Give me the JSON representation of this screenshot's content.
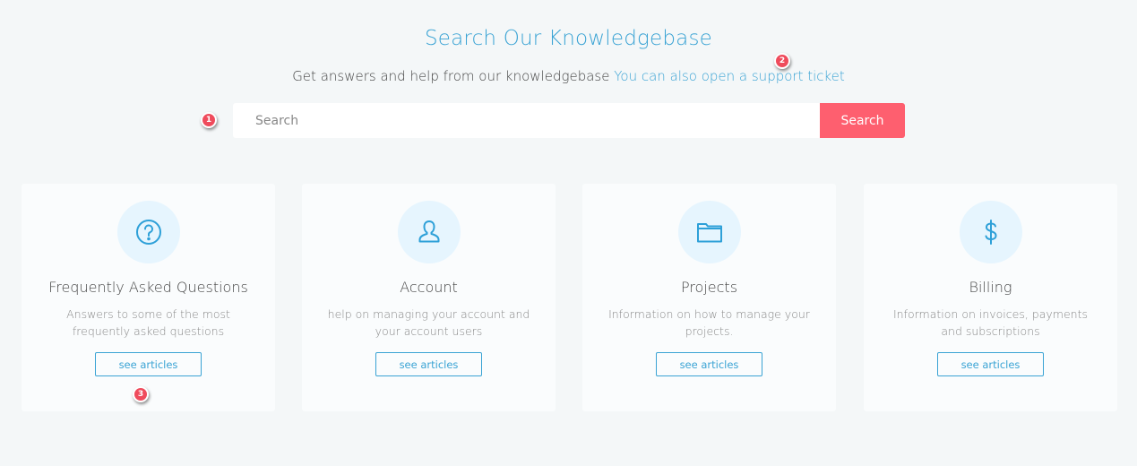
{
  "header": {
    "title": "Search Our Knowledgebase",
    "subtitle": "Get answers and help from our knowledgebase",
    "support_link": "You can also open a support ticket"
  },
  "search": {
    "placeholder": "Search",
    "value": "",
    "button_label": "Search"
  },
  "cards": [
    {
      "icon": "question-circle-icon",
      "title": "Frequently Asked Questions",
      "description": "Answers to some of the most frequently asked questions",
      "button_label": "see articles"
    },
    {
      "icon": "user-icon",
      "title": "Account",
      "description": "help on managing your account and your account users",
      "button_label": "see articles"
    },
    {
      "icon": "folder-icon",
      "title": "Projects",
      "description": "Information on how to manage your projects.",
      "button_label": "see articles"
    },
    {
      "icon": "dollar-icon",
      "title": "Billing",
      "description": "Information on invoices, payments and subscriptions",
      "button_label": "see articles"
    }
  ],
  "markers": [
    "1",
    "2",
    "3"
  ],
  "colors": {
    "accent": "#3aa3d4",
    "search_button": "#fe5f6f",
    "background": "#f4f7f8",
    "icon_circle": "#e6f5fe",
    "marker": "#ef4b5c"
  }
}
